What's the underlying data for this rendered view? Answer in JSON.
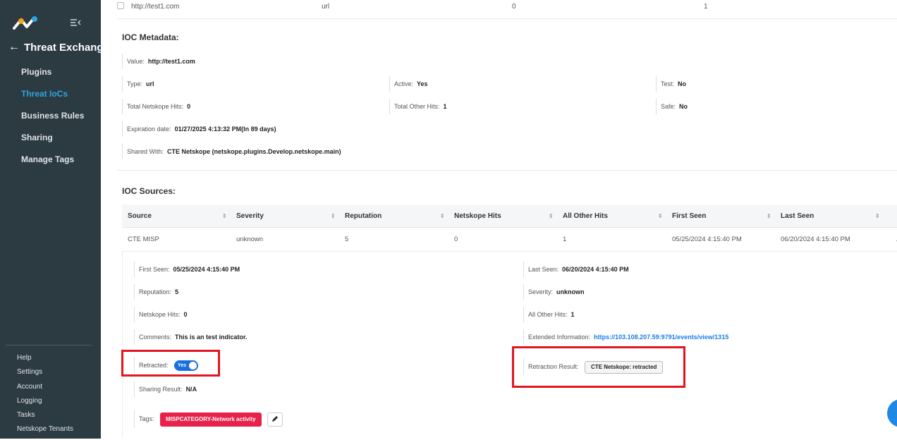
{
  "sidebar": {
    "back_label": "Threat Exchange",
    "nav": [
      "Plugins",
      "Threat IoCs",
      "Business Rules",
      "Sharing",
      "Manage Tags"
    ],
    "active_item": "Threat IoCs",
    "bottom_nav": [
      "Help",
      "Settings",
      "Account",
      "Logging",
      "Tasks",
      "Netskope Tenants"
    ]
  },
  "top_row": {
    "value": "http://test1.com",
    "type": "url",
    "col3": "0",
    "col4": "1"
  },
  "metadata": {
    "title": "IOC Metadata:",
    "value_label": "Value:",
    "value": "http://test1.com",
    "type_label": "Type:",
    "type": "url",
    "active_label": "Active:",
    "active": "Yes",
    "test_label": "Test:",
    "test": "No",
    "netskope_hits_label": "Total Netskope Hits:",
    "netskope_hits": "0",
    "other_hits_label": "Total Other Hits:",
    "other_hits": "1",
    "safe_label": "Safe:",
    "safe": "No",
    "expiration_label": "Expiration date:",
    "expiration": "01/27/2025 4:13:32 PM(In 89 days)",
    "shared_label": "Shared With:",
    "shared": "CTE Netskope (netskope.plugins.Develop.netskope.main)"
  },
  "sources": {
    "title": "IOC Sources:",
    "columns": [
      "Source",
      "Severity",
      "Reputation",
      "Netskope Hits",
      "All Other Hits",
      "First Seen",
      "Last Seen"
    ],
    "row": [
      "CTE MISP",
      "unknown",
      "5",
      "0",
      "1",
      "05/25/2024 4:15:40 PM",
      "06/20/2024 4:15:40 PM"
    ]
  },
  "detail": {
    "first_seen_label": "First Seen:",
    "first_seen": "05/25/2024 4:15:40 PM",
    "last_seen_label": "Last Seen:",
    "last_seen": "06/20/2024 4:15:40 PM",
    "reputation_label": "Reputation:",
    "reputation": "5",
    "severity_label": "Severity:",
    "severity": "unknown",
    "netskope_hits_label": "Netskope Hits:",
    "netskope_hits": "0",
    "other_hits_label": "All Other Hits:",
    "other_hits": "1",
    "comments_label": "Comments:",
    "comments": "This is an test indicator.",
    "ext_info_label": "Extended Information:",
    "ext_info": "https://103.108.207.59:9791/events/view/1315",
    "retracted_label": "Retracted:",
    "retracted_toggle": "Yes",
    "retraction_result_label": "Retraction Result:",
    "retraction_result": "CTE Netskope: retracted",
    "sharing_result_label": "Sharing Result:",
    "sharing_result": "N/A",
    "tags_label": "Tags:",
    "tag": "MISPCATEGORY-Network activity"
  },
  "colors": {
    "sidebar_bg": "#2c3a42",
    "active_nav": "#2aa7df",
    "toggle": "#1a6fe0",
    "tag": "#e8214a",
    "highlight": "#e3151f",
    "link": "#1a7ee6"
  }
}
